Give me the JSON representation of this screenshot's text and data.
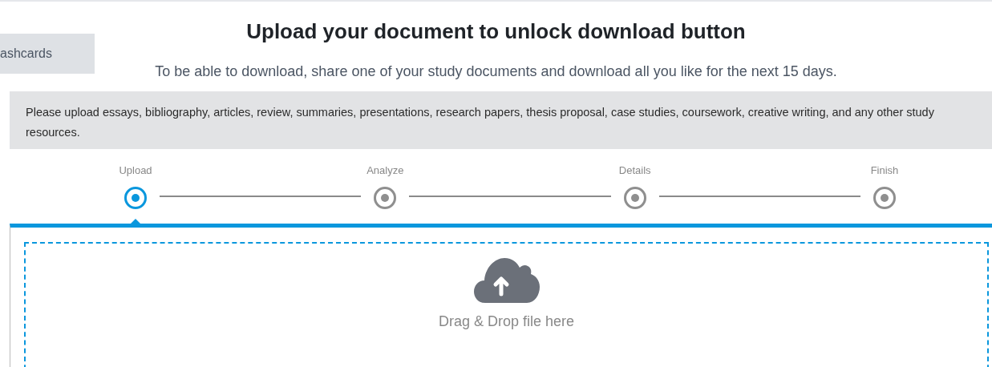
{
  "sidebar_tab": {
    "label": "ashcards"
  },
  "title": "Upload your document to unlock download button",
  "subtitle": "To be able to download, share one of your study documents and download all you like for the next 15 days.",
  "notice": "Please upload essays, bibliography, articles, review, summaries, presentations, research papers, thesis proposal, case studies, coursework, creative writing, and any other study resources.",
  "steps": [
    {
      "label": "Upload",
      "selected": true
    },
    {
      "label": "Analyze",
      "selected": false
    },
    {
      "label": "Details",
      "selected": false
    },
    {
      "label": "Finish",
      "selected": false
    }
  ],
  "dropzone": {
    "hint": "Drag & Drop file here"
  }
}
